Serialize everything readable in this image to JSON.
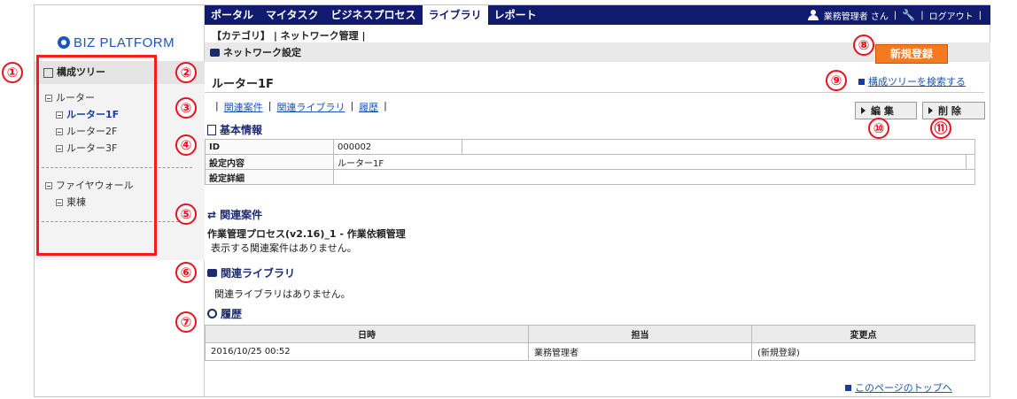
{
  "brand": {
    "logo_text": "BIZ PLATFORM"
  },
  "nav": {
    "items": [
      "ポータル",
      "マイタスク",
      "ビジネスプロセス",
      "ライブラリ",
      "レポート"
    ],
    "active_index": 3,
    "user": "業務管理者 さん",
    "logout": "ログアウト"
  },
  "breadcrumb": "【カテゴリ】 | ネットワーク管理 |",
  "subheader": "ネットワーク設定",
  "new_button": "新規登録",
  "tree": {
    "title": "構成ツリー",
    "groups": [
      {
        "label": "ルーター",
        "children": [
          "ルーター1F",
          "ルーター2F",
          "ルーター3F"
        ],
        "active_child": 0
      },
      {
        "label": "ファイヤウォール",
        "children": [
          "東棟"
        ]
      }
    ]
  },
  "page_title": "ルーター1F",
  "search_link": "構成ツリーを検索する",
  "tabs": [
    "関連案件",
    "関連ライブラリ",
    "履歴"
  ],
  "edit_button": "編 集",
  "delete_button": "削 除",
  "sections": {
    "basic": "基本情報",
    "related_cases": "関連案件",
    "related_library": "関連ライブラリ",
    "history": "履歴"
  },
  "basic_info": [
    {
      "key": "ID",
      "value": "000002"
    },
    {
      "key": "設定内容",
      "value": "ルーター1F"
    },
    {
      "key": "設定詳細",
      "value": ""
    }
  ],
  "related_process": "作業管理プロセス(v2.16)_1 - 作業依頼管理",
  "related_none": "表示する関連案件はありません。",
  "library_none": "関連ライブラリはありません。",
  "history": {
    "headers": [
      "日時",
      "担当",
      "変更点"
    ],
    "rows": [
      [
        "2016/10/25 00:52",
        "業務管理者",
        "(新規登録)"
      ]
    ]
  },
  "page_top_link": "このページのトップへ",
  "markers": [
    "①",
    "②",
    "③",
    "④",
    "⑤",
    "⑥",
    "⑦",
    "⑧",
    "⑨",
    "⑩",
    "⑪"
  ],
  "colors": {
    "nav_bg": "#101a6e",
    "accent_orange": "#f47920",
    "marker_red": "#e8121e",
    "link_blue": "#1a57b8"
  }
}
